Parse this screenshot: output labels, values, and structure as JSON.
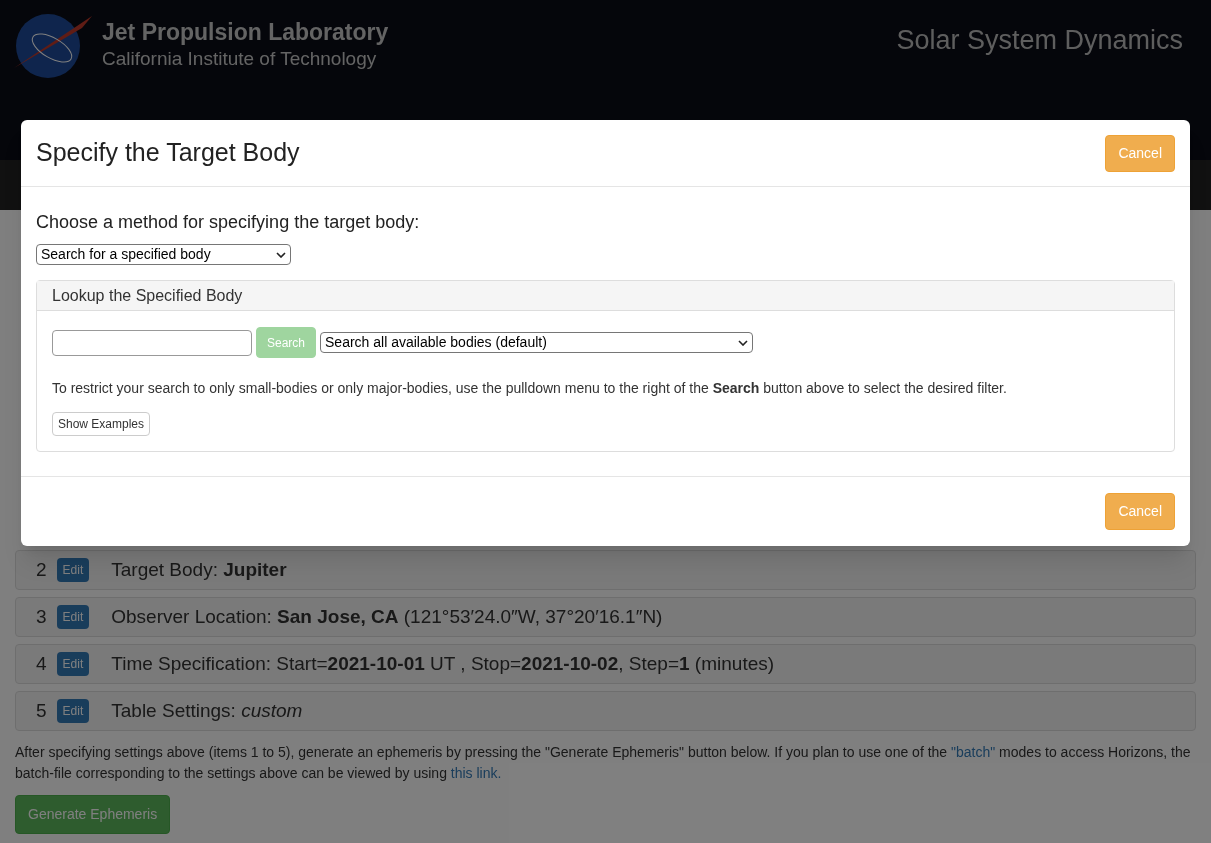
{
  "header": {
    "title": "Jet Propulsion Laboratory",
    "subtitle": "California Institute of Technology",
    "section": "Solar System Dynamics"
  },
  "settings": [
    {
      "number": "2",
      "edit": "Edit",
      "text": "Target Body: **Jupiter**"
    },
    {
      "number": "3",
      "edit": "Edit",
      "text": "Observer Location: **San Jose, CA** (121°53′24.0″W, 37°20′16.1″N)"
    },
    {
      "number": "4",
      "edit": "Edit",
      "text": "Time Specification: Start=**2021-10-01** UT , Stop=**2021-10-02**, Step=**1** (minutes)"
    },
    {
      "number": "5",
      "edit": "Edit",
      "text": "Table Settings: *custom*"
    }
  ],
  "instructions": {
    "parts": [
      {
        "kind": "text",
        "text": "After specifying settings above (items 1 to 5), generate an ephemeris by pressing the \"Generate Ephemeris\" button below. If you plan to use one of the "
      },
      {
        "kind": "link",
        "text": "\"batch\""
      },
      {
        "kind": "text",
        "text": " modes to access Horizons, the batch-file corresponding to the settings above can be viewed by using "
      },
      {
        "kind": "link",
        "text": "this link."
      }
    ]
  },
  "generate_button": "Generate Ephemeris",
  "modal": {
    "title": "Specify the Target Body",
    "cancel_top": "Cancel",
    "method_label": "Choose a method for specifying the target body:",
    "method_select": "Search for a specified body",
    "panel": {
      "heading": "Lookup the Specified Body",
      "search_button": {
        "label": "Search",
        "disabled": true
      },
      "filter_select": "Search all available bodies (default)",
      "help": "To restrict your search to only small-bodies or only major-bodies, use the pulldown menu to the right of the **Search** button above to select the desired filter.",
      "examples_button": "Show Examples"
    },
    "cancel_bottom": "Cancel"
  }
}
